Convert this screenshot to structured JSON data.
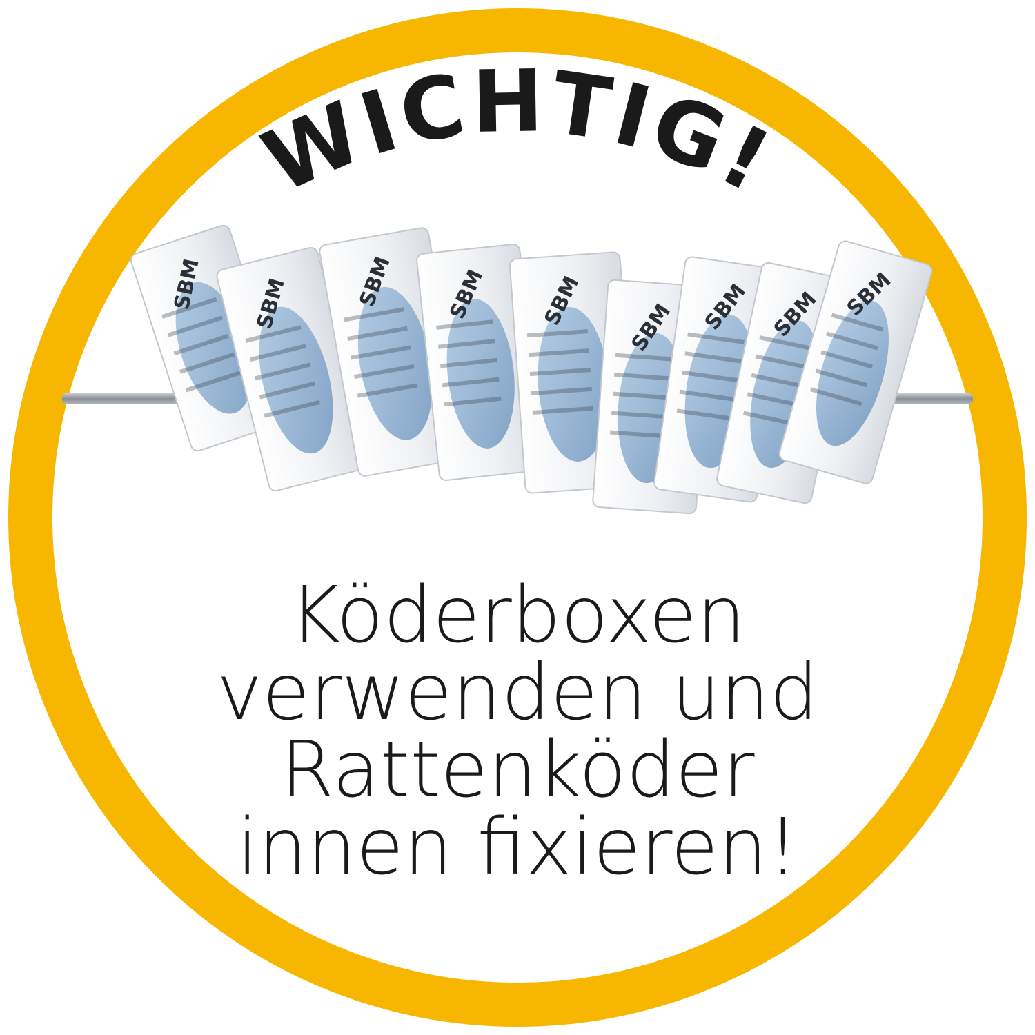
{
  "badge": {
    "headline": "WICHTIG!",
    "message_lines": [
      "Köderboxen",
      "verwenden und",
      "Rattenköder",
      "innen fixieren!"
    ],
    "ring_color": "#f7b600",
    "text_color": "#1a1a1a"
  },
  "product_image": {
    "description_name": "rat-bait-sachets-on-metal-rod",
    "sachet_labels": [
      "SBM",
      "SBM",
      "SBM",
      "SBM",
      "SBM",
      "SBM",
      "SBM",
      "SBM",
      "SBM"
    ],
    "bait_color": "#8fb4d6"
  }
}
